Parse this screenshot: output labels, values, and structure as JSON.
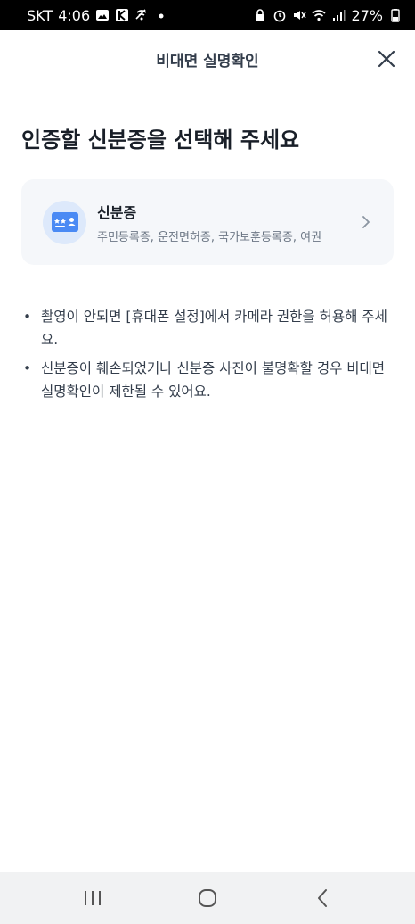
{
  "status_bar": {
    "carrier": "SKT",
    "time": "4:06",
    "battery": "27%"
  },
  "header": {
    "title": "비대면 실명확인",
    "close_icon": "close-icon"
  },
  "page_title": "인증할 신분증을 선택해 주세요",
  "option": {
    "title": "신분증",
    "subtitle": "주민등록증, 운전면허증, 국가보훈등록증, 여권",
    "icon": "id-card-icon",
    "accent": "#4a8af4"
  },
  "notices": [
    "촬영이 안되면 [휴대폰 설정]에서 카메라 권한을 허용해 주세요.",
    "신분증이 훼손되었거나 신분증 사진이 불명확할 경우 비대면 실명확인이 제한될 수 있어요."
  ],
  "nav": {
    "recent_icon": "recent-apps-icon",
    "home_icon": "home-icon",
    "back_icon": "back-icon"
  }
}
